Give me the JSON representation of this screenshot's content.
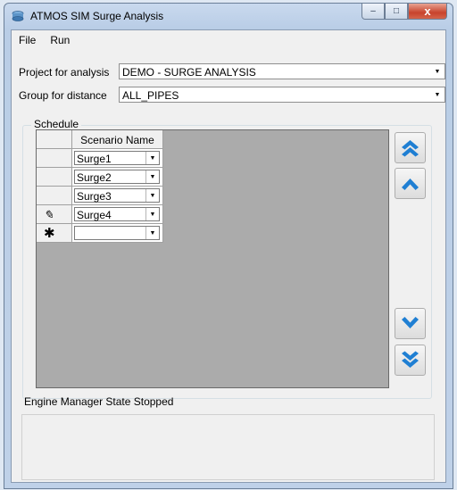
{
  "window": {
    "title": "ATMOS SIM Surge Analysis",
    "buttons": {
      "minimize": "–",
      "maximize": "□",
      "close": "x"
    }
  },
  "menu": {
    "items": [
      "File",
      "Run"
    ]
  },
  "form": {
    "project_label": "Project for analysis",
    "project_value": "DEMO - SURGE ANALYSIS",
    "group_label": "Group for distance",
    "group_value": "ALL_PIPES"
  },
  "schedule": {
    "title": "Schedule",
    "column_header": "Scenario Name",
    "rows": [
      {
        "value": "Surge1",
        "indicator": ""
      },
      {
        "value": "Surge2",
        "indicator": ""
      },
      {
        "value": "Surge3",
        "indicator": ""
      },
      {
        "value": "Surge4",
        "indicator": "pencil-icon"
      },
      {
        "value": "",
        "indicator": "new-row-icon"
      }
    ],
    "nav_buttons": [
      "move-to-top",
      "move-up",
      "move-down",
      "move-to-bottom"
    ]
  },
  "status": {
    "text": "Engine Manager State Stopped"
  },
  "colors": {
    "accent_blue": "#1f7fd3",
    "grid_bg": "#ababab",
    "client_bg": "#f0f0f0"
  }
}
